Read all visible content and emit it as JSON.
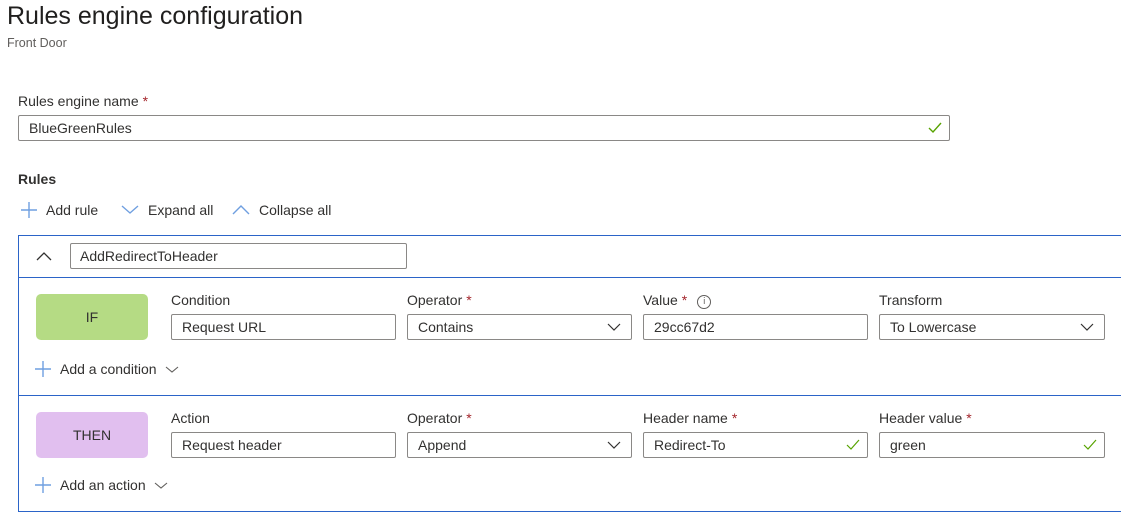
{
  "header": {
    "title": "Rules engine configuration",
    "subtitle": "Front Door"
  },
  "engine_name": {
    "label": "Rules engine name",
    "required_marker": "*",
    "value": "BlueGreenRules",
    "valid": true
  },
  "rules": {
    "section_label": "Rules",
    "toolbar": {
      "add_rule": "Add rule",
      "expand_all": "Expand all",
      "collapse_all": "Collapse all"
    },
    "items": [
      {
        "name": "AddRedirectToHeader",
        "expanded": true,
        "if_block": {
          "badge": "IF",
          "badge_color": "#b5db84",
          "fields": {
            "condition": {
              "label": "Condition",
              "value": "Request URL"
            },
            "operator": {
              "label": "Operator",
              "required_marker": "*",
              "value": "Contains"
            },
            "value": {
              "label": "Value",
              "required_marker": "*",
              "value": "29cc67d2",
              "info_icon": "i"
            },
            "transform": {
              "label": "Transform",
              "value": "To Lowercase"
            }
          },
          "add_link": "Add a condition"
        },
        "then_block": {
          "badge": "THEN",
          "badge_color": "#e1bfef",
          "fields": {
            "action": {
              "label": "Action",
              "value": "Request header"
            },
            "operator": {
              "label": "Operator",
              "required_marker": "*",
              "value": "Append"
            },
            "header_name": {
              "label": "Header name",
              "required_marker": "*",
              "value": "Redirect-To",
              "valid": true
            },
            "header_value": {
              "label": "Header value",
              "required_marker": "*",
              "value": "green",
              "valid": true
            }
          },
          "add_link": "Add an action"
        }
      }
    ]
  },
  "colors": {
    "accent": "#2b64c8",
    "required": "#a4262c",
    "valid_check": "#57a300",
    "icon_blue": "#6f9fe0"
  }
}
